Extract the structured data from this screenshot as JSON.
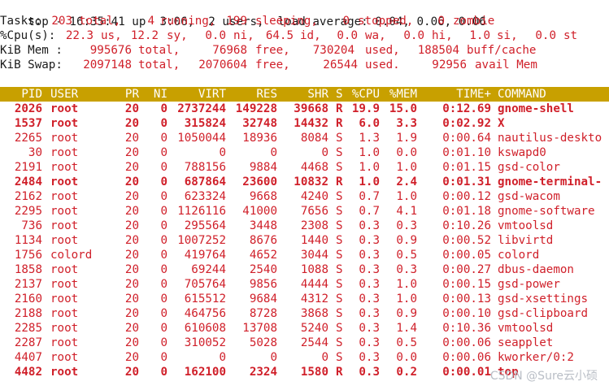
{
  "summary": {
    "top_label": "top - 16:35:41 up  3:06,  2 users,  load average: 0.04, 0.06, 0.06",
    "tasks": {
      "label": "Tasks:",
      "total_value": "203",
      "total_label": "total,",
      "running_value": "4",
      "running_label": "running,",
      "sleeping_value": "199",
      "sleeping_label": "sleeping,",
      "stopped_value": "0",
      "stopped_label": "stopped,",
      "zombie_value": "0",
      "zombie_label": "zombie"
    },
    "cpu": {
      "label": "%Cpu(s):",
      "us_value": "22.3",
      "us_label": "us,",
      "sy_value": "12.2",
      "sy_label": "sy,",
      "ni_value": "0.0",
      "ni_label": "ni,",
      "id_value": "64.5",
      "id_label": "id,",
      "wa_value": "0.0",
      "wa_label": "wa,",
      "hi_value": "0.0",
      "hi_label": "hi,",
      "si_value": "1.0",
      "si_label": "si,",
      "st_value": "0.0",
      "st_label": "st"
    },
    "mem": {
      "label": "KiB Mem :",
      "total_value": "995676",
      "total_label": "total,",
      "free_value": "76968",
      "free_label": "free,",
      "used_value": "730204",
      "used_label": "used,",
      "cache_value": "188504",
      "cache_label": "buff/cache"
    },
    "swap": {
      "label": "KiB Swap:",
      "total_value": "2097148",
      "total_label": "total,",
      "free_value": "2070604",
      "free_label": "free,",
      "used_value": "26544",
      "used_label": "used.",
      "avail_value": "92956",
      "avail_label": "avail Mem"
    }
  },
  "columns": [
    "PID",
    "USER",
    "PR",
    "NI",
    "VIRT",
    "RES",
    "SHR",
    "S",
    "%CPU",
    "%MEM",
    "TIME+",
    "COMMAND"
  ],
  "processes": [
    {
      "pid": "2026",
      "user": "root",
      "pr": "20",
      "ni": "0",
      "virt": "2737244",
      "res": "149228",
      "shr": "39668",
      "s": "R",
      "cpu": "19.9",
      "mem": "15.0",
      "time": "0:12.69",
      "command": "gnome-shell",
      "bold": true
    },
    {
      "pid": "1537",
      "user": "root",
      "pr": "20",
      "ni": "0",
      "virt": "315824",
      "res": "32748",
      "shr": "14432",
      "s": "R",
      "cpu": "6.0",
      "mem": "3.3",
      "time": "0:02.92",
      "command": "X",
      "bold": true
    },
    {
      "pid": "2265",
      "user": "root",
      "pr": "20",
      "ni": "0",
      "virt": "1050044",
      "res": "18936",
      "shr": "8084",
      "s": "S",
      "cpu": "1.3",
      "mem": "1.9",
      "time": "0:00.64",
      "command": "nautilus-deskto",
      "bold": false
    },
    {
      "pid": "30",
      "user": "root",
      "pr": "20",
      "ni": "0",
      "virt": "0",
      "res": "0",
      "shr": "0",
      "s": "S",
      "cpu": "1.0",
      "mem": "0.0",
      "time": "0:01.10",
      "command": "kswapd0",
      "bold": false
    },
    {
      "pid": "2191",
      "user": "root",
      "pr": "20",
      "ni": "0",
      "virt": "788156",
      "res": "9884",
      "shr": "4468",
      "s": "S",
      "cpu": "1.0",
      "mem": "1.0",
      "time": "0:01.15",
      "command": "gsd-color",
      "bold": false
    },
    {
      "pid": "2484",
      "user": "root",
      "pr": "20",
      "ni": "0",
      "virt": "687864",
      "res": "23600",
      "shr": "10832",
      "s": "R",
      "cpu": "1.0",
      "mem": "2.4",
      "time": "0:01.31",
      "command": "gnome-terminal-",
      "bold": true
    },
    {
      "pid": "2162",
      "user": "root",
      "pr": "20",
      "ni": "0",
      "virt": "623324",
      "res": "9668",
      "shr": "4240",
      "s": "S",
      "cpu": "0.7",
      "mem": "1.0",
      "time": "0:00.12",
      "command": "gsd-wacom",
      "bold": false
    },
    {
      "pid": "2295",
      "user": "root",
      "pr": "20",
      "ni": "0",
      "virt": "1126116",
      "res": "41000",
      "shr": "7656",
      "s": "S",
      "cpu": "0.7",
      "mem": "4.1",
      "time": "0:01.18",
      "command": "gnome-software",
      "bold": false
    },
    {
      "pid": "736",
      "user": "root",
      "pr": "20",
      "ni": "0",
      "virt": "295564",
      "res": "3448",
      "shr": "2308",
      "s": "S",
      "cpu": "0.3",
      "mem": "0.3",
      "time": "0:10.26",
      "command": "vmtoolsd",
      "bold": false
    },
    {
      "pid": "1134",
      "user": "root",
      "pr": "20",
      "ni": "0",
      "virt": "1007252",
      "res": "8676",
      "shr": "1440",
      "s": "S",
      "cpu": "0.3",
      "mem": "0.9",
      "time": "0:00.52",
      "command": "libvirtd",
      "bold": false
    },
    {
      "pid": "1756",
      "user": "colord",
      "pr": "20",
      "ni": "0",
      "virt": "419764",
      "res": "4652",
      "shr": "3044",
      "s": "S",
      "cpu": "0.3",
      "mem": "0.5",
      "time": "0:00.05",
      "command": "colord",
      "bold": false
    },
    {
      "pid": "1858",
      "user": "root",
      "pr": "20",
      "ni": "0",
      "virt": "69244",
      "res": "2540",
      "shr": "1088",
      "s": "S",
      "cpu": "0.3",
      "mem": "0.3",
      "time": "0:00.27",
      "command": "dbus-daemon",
      "bold": false
    },
    {
      "pid": "2137",
      "user": "root",
      "pr": "20",
      "ni": "0",
      "virt": "705764",
      "res": "9856",
      "shr": "4444",
      "s": "S",
      "cpu": "0.3",
      "mem": "1.0",
      "time": "0:00.15",
      "command": "gsd-power",
      "bold": false
    },
    {
      "pid": "2160",
      "user": "root",
      "pr": "20",
      "ni": "0",
      "virt": "615512",
      "res": "9684",
      "shr": "4312",
      "s": "S",
      "cpu": "0.3",
      "mem": "1.0",
      "time": "0:00.13",
      "command": "gsd-xsettings",
      "bold": false
    },
    {
      "pid": "2188",
      "user": "root",
      "pr": "20",
      "ni": "0",
      "virt": "464756",
      "res": "8728",
      "shr": "3868",
      "s": "S",
      "cpu": "0.3",
      "mem": "0.9",
      "time": "0:00.10",
      "command": "gsd-clipboard",
      "bold": false
    },
    {
      "pid": "2285",
      "user": "root",
      "pr": "20",
      "ni": "0",
      "virt": "610608",
      "res": "13708",
      "shr": "5240",
      "s": "S",
      "cpu": "0.3",
      "mem": "1.4",
      "time": "0:10.36",
      "command": "vmtoolsd",
      "bold": false
    },
    {
      "pid": "2287",
      "user": "root",
      "pr": "20",
      "ni": "0",
      "virt": "310052",
      "res": "5028",
      "shr": "2544",
      "s": "S",
      "cpu": "0.3",
      "mem": "0.5",
      "time": "0:00.06",
      "command": "seapplet",
      "bold": false
    },
    {
      "pid": "4407",
      "user": "root",
      "pr": "20",
      "ni": "0",
      "virt": "0",
      "res": "0",
      "shr": "0",
      "s": "S",
      "cpu": "0.3",
      "mem": "0.0",
      "time": "0:00.06",
      "command": "kworker/0:2",
      "bold": false
    },
    {
      "pid": "4482",
      "user": "root",
      "pr": "20",
      "ni": "0",
      "virt": "162100",
      "res": "2324",
      "shr": "1580",
      "s": "R",
      "cpu": "0.3",
      "mem": "0.2",
      "time": "0:00.01",
      "command": "top",
      "bold": true
    }
  ],
  "watermark": "CSDN @Sure云小硕",
  "colors": {
    "highlight": "#d0202a",
    "header_bg": "#c8a000",
    "header_text": "#ffffff",
    "text": "#1a1a1a",
    "background": "#ffffff"
  }
}
